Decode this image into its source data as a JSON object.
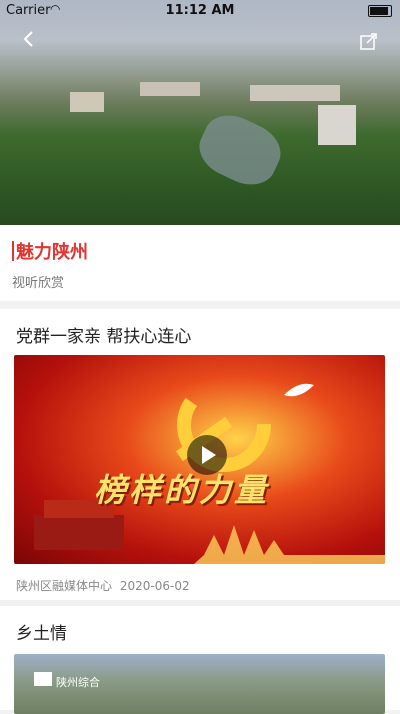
{
  "status": {
    "carrier": "Carrier",
    "time": "11:12 AM"
  },
  "header": {
    "title": "魅力陕州",
    "subtitle": "视听欣赏"
  },
  "items": [
    {
      "title": "党群一家亲 帮扶心连心",
      "banner_text": "榜样的力量",
      "source": "陕州区融媒体中心",
      "date": "2020-06-02"
    },
    {
      "title": "乡土情",
      "logo_text": "陕州综合"
    }
  ],
  "colors": {
    "accent": "#e3342f"
  }
}
